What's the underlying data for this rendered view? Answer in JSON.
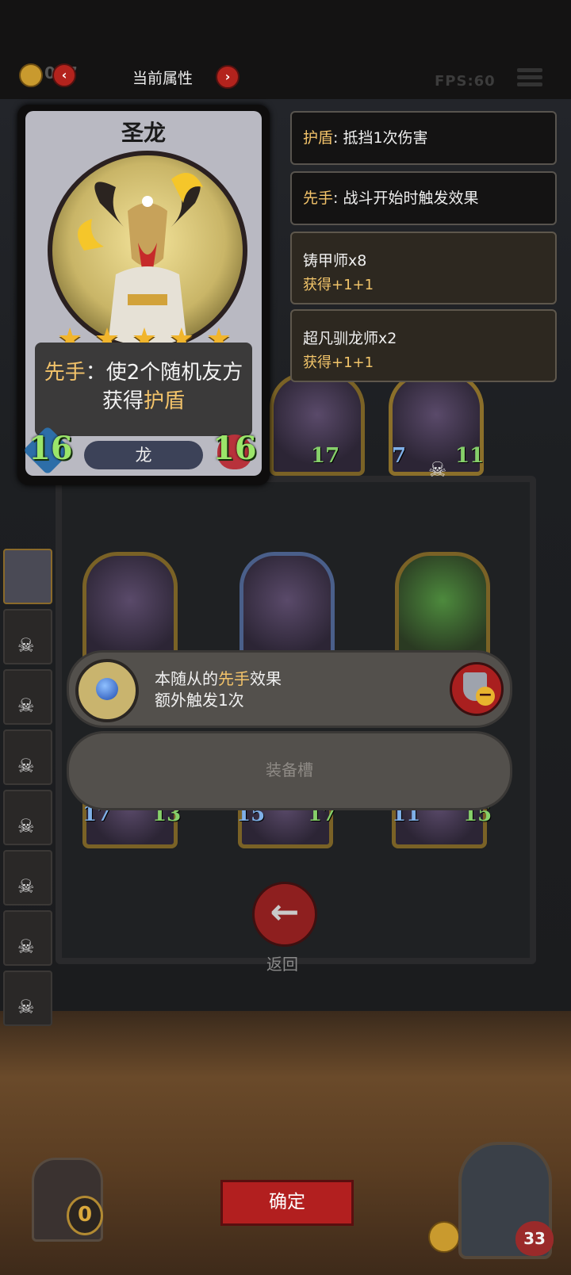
{
  "header": {
    "gold": "0",
    "gold_suffix": "17",
    "title": "当前属性",
    "prev_icon": "chevron-left-icon",
    "next_icon": "chevron-right-icon",
    "fps": "FPS:60"
  },
  "card": {
    "name": "圣龙",
    "stars": 5,
    "ability_prefix": "先手",
    "ability_mid": "：使2个随机友方获得",
    "ability_keyword": "护盾",
    "tribe": "龙",
    "attack": "16",
    "health": "16"
  },
  "keywords": [
    {
      "term": "护盾",
      "desc": ": 抵挡1次伤害"
    },
    {
      "term": "先手",
      "desc": ": 战斗开始时触发效果"
    }
  ],
  "synergies": [
    {
      "name": "铸甲师x8",
      "gain": "获得+1+1"
    },
    {
      "name": "超凡驯龙师x2",
      "gain": "获得+1+1"
    }
  ],
  "board": {
    "row1_stats": [
      {
        "atk": "",
        "hp": "17"
      },
      {
        "atk": "7",
        "hp": "11"
      }
    ],
    "row3_stats": [
      {
        "atk": "17",
        "hp": "13"
      },
      {
        "atk": "15",
        "hp": "17"
      },
      {
        "atk": "11",
        "hp": "15"
      }
    ]
  },
  "equipment": {
    "item_text_1": "本随从的",
    "item_keyword": "先手",
    "item_text_2": "效果",
    "item_line2": "额外触发1次",
    "slot_label": "装备槽"
  },
  "buttons": {
    "return_label": "返回",
    "confirm_label": "确定"
  },
  "bottom": {
    "gold": "0",
    "hero_hp": "33"
  },
  "colors": {
    "accent_gold": "#f3c36a",
    "button_red": "#b21f1f",
    "stat_green": "#9be56a"
  }
}
